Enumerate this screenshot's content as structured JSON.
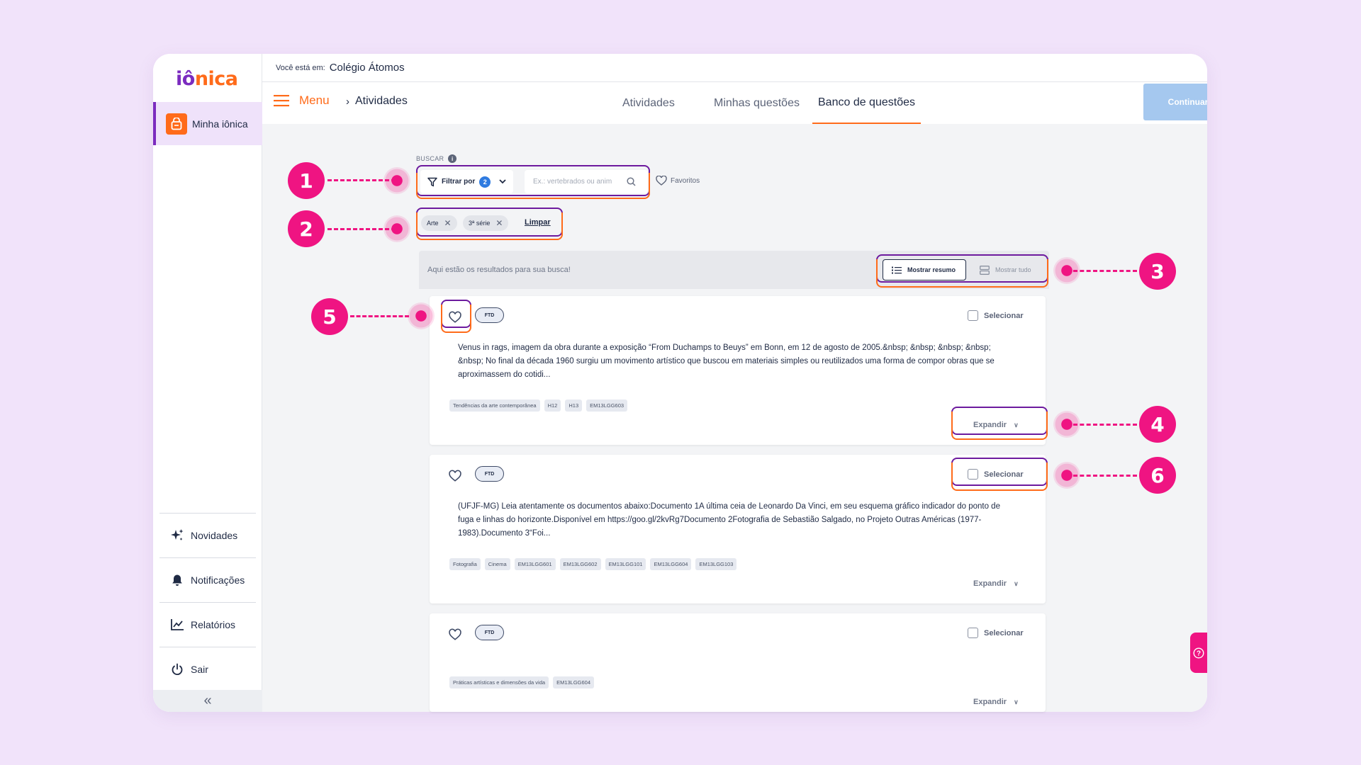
{
  "app": {
    "logo_part1": "iô",
    "logo_part2": "nica",
    "location_label": "Você está em:",
    "location_value": "Colégio Átomos"
  },
  "sidebar": {
    "active_item": "Minha iônica",
    "items": [
      {
        "label": "Novidades",
        "icon": "sparkles-icon"
      },
      {
        "label": "Notificações",
        "icon": "bell-icon"
      },
      {
        "label": "Relatórios",
        "icon": "chart-line-icon"
      },
      {
        "label": "Sair",
        "icon": "power-icon"
      }
    ],
    "collapse_glyph": "«"
  },
  "nav": {
    "menu_label": "Menu",
    "breadcrumb": "Atividades",
    "tabs": [
      "Atividades",
      "Minhas questões",
      "Banco de questões"
    ],
    "active_tab": "Banco de questões",
    "continue_label": "Continuar"
  },
  "filters": {
    "buscar_label": "BUSCAR",
    "filter_label": "Filtrar por",
    "filter_count": "2",
    "search_placeholder": "Ex.: vertebrados ou anim",
    "favorites_label": "Favoritos",
    "chips": [
      "Arte",
      "3ª série"
    ],
    "clear_label": "Limpar"
  },
  "results": {
    "message": "Aqui estão os resultados para sua busca!",
    "view_summary": "Mostrar resumo",
    "view_all": "Mostrar tudo"
  },
  "cards": [
    {
      "badge": "FTD",
      "select_label": "Selecionar",
      "text": "Venus in rags, imagem da obra durante a exposição “From Duchamps to Beuys” em Bonn, em 12 de agosto de 2005.&nbsp; &nbsp; &nbsp; &nbsp; &nbsp; No final da década 1960 surgiu um movimento artístico que buscou em materiais simples ou reutilizados uma forma de compor obras que se aproximassem do cotidi...",
      "tags": [
        "Tendências da arte contemporânea",
        "H12",
        "H13",
        "EM13LGG603"
      ],
      "expand_label": "Expandir"
    },
    {
      "badge": "FTD",
      "select_label": "Selecionar",
      "text": "(UFJF-MG) Leia atentamente os documentos abaixo:Documento 1A última ceia de Leonardo Da Vinci, em seu esquema gráfico indicador do ponto de fuga e linhas do horizonte.Disponível em https://goo.gl/2kvRg7Documento 2Fotografia de Sebastião Salgado, no Projeto Outras Américas (1977-1983).Documento 3“Foi...",
      "tags": [
        "Fotografia",
        "Cinema",
        "EM13LGG601",
        "EM13LGG602",
        "EM13LGG101",
        "EM13LGG604",
        "EM13LGG103"
      ],
      "expand_label": "Expandir"
    },
    {
      "badge": "FTD",
      "select_label": "Selecionar",
      "text": "",
      "tags": [
        "Práticas artísticas e dimensões da vida",
        "EM13LGG604"
      ],
      "expand_label": "Expandir"
    }
  ],
  "annotations": [
    "1",
    "2",
    "3",
    "4",
    "5",
    "6"
  ],
  "colors": {
    "brand_purple": "#7b2cbf",
    "brand_orange": "#ff6b1a",
    "annotation_pink": "#ef1482",
    "continue_disabled": "#a5c8ef"
  }
}
